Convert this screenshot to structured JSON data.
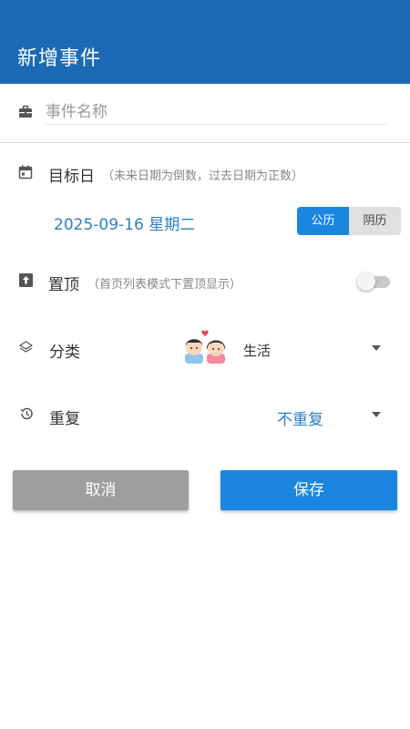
{
  "header": {
    "title": "新增事件"
  },
  "name_field": {
    "placeholder": "事件名称",
    "value": ""
  },
  "target_date": {
    "label": "目标日",
    "hint": "（未来日期为倒数，过去日期为正数）",
    "value": "2025-09-16 星期二",
    "calendar_options": [
      "公历",
      "阴历"
    ],
    "selected_calendar": "公历"
  },
  "pin_top": {
    "label": "置顶",
    "hint": "（首页列表模式下置顶显示）",
    "enabled": false
  },
  "category": {
    "label": "分类",
    "value": "生活",
    "icon": "couple-avatar-icon"
  },
  "repeat": {
    "label": "重复",
    "value": "不重复"
  },
  "actions": {
    "cancel_label": "取消",
    "save_label": "保存"
  },
  "colors": {
    "header": "#1c6ab5",
    "accent": "#1a86e0",
    "value_text": "#2c7fc4",
    "cancel_button": "#9e9e9e"
  }
}
